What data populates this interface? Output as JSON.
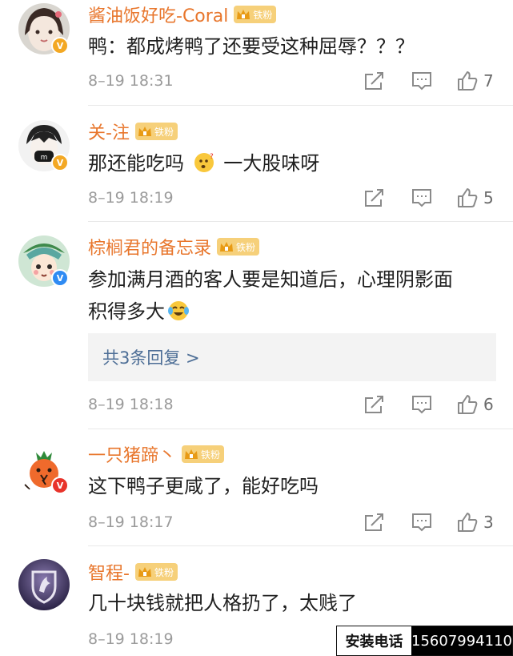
{
  "fan_badge_label": "铁粉",
  "comments": [
    {
      "name": "酱油饭好吃-Coral",
      "text": "鸭：都成烤鸭了还要受这种屈辱？？？",
      "time": "8–19 18:31",
      "likes": "7",
      "badge": "V",
      "badge_color": "#f3a824"
    },
    {
      "name": "关-注",
      "text_a": "那还能吃吗",
      "text_b": "一大股味呀",
      "time": "8–19 18:19",
      "likes": "5",
      "badge": "V",
      "badge_color": "#f3a824"
    },
    {
      "name": "棕榈君的备忘录",
      "text_line1": "参加满月酒的客人要是知道后，心理阴影面",
      "text_line2": "积得多大",
      "replies_label": "共3条回复 >",
      "time": "8–19 18:18",
      "likes": "6",
      "badge": "V",
      "badge_color": "#2f8bf3"
    },
    {
      "name": "一只猪蹄丶",
      "text": "这下鸭子更咸了，能好吃吗",
      "time": "8–19 18:17",
      "likes": "3",
      "badge": "V",
      "badge_color": "#e8332a"
    },
    {
      "name": "智程-",
      "text": "几十块钱就把人格扔了，太贱了",
      "time": "8–19 18:19",
      "likes": ""
    }
  ],
  "ad": {
    "label": "安装电话",
    "phone": "15607994110"
  },
  "icons": [
    "share-icon",
    "comment-icon",
    "like-icon",
    "thinking-emoji",
    "laughing-crying-emoji",
    "crown-icon"
  ],
  "colors": {
    "name": "#e8762c",
    "reply_link": "#4d6e96",
    "meta": "#9b9b9b"
  }
}
